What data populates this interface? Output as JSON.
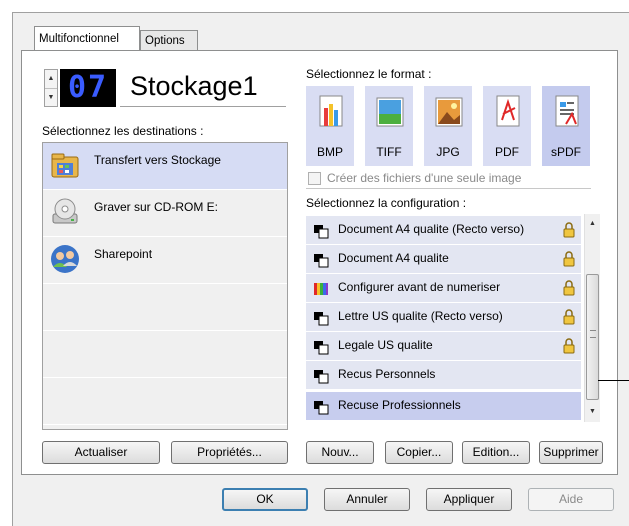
{
  "tabs": [
    {
      "label": "Multifonctionnel"
    },
    {
      "label": "Options"
    }
  ],
  "profile": {
    "number": "07",
    "name": "Stockage1"
  },
  "destinations": {
    "label": "Sélectionnez les destinations :",
    "items": [
      {
        "label": "Transfert vers Stockage",
        "icon": "storage-icon",
        "selected": true
      },
      {
        "label": "Graver sur CD-ROM  E:",
        "icon": "cd-rom-icon",
        "selected": false
      },
      {
        "label": "Sharepoint",
        "icon": "sharepoint-icon",
        "selected": false
      }
    ]
  },
  "format": {
    "label": "Sélectionnez le format :",
    "items": [
      {
        "label": "BMP",
        "icon": "bmp-icon"
      },
      {
        "label": "TIFF",
        "icon": "tiff-icon"
      },
      {
        "label": "JPG",
        "icon": "jpg-icon"
      },
      {
        "label": "PDF",
        "icon": "pdf-icon"
      },
      {
        "label": "sPDF",
        "icon": "spdf-icon",
        "selected": true
      }
    ],
    "single_image_label": "Créer des fichiers d'une seule image"
  },
  "configuration": {
    "label": "Sélectionnez la configuration :",
    "items": [
      {
        "label": "Document A4 qualite (Recto verso)",
        "locked": true
      },
      {
        "label": "Document A4 qualite",
        "locked": true
      },
      {
        "label": "Configurer avant de numeriser",
        "locked": true
      },
      {
        "label": "Lettre US qualite (Recto verso)",
        "locked": true
      },
      {
        "label": "Legale US qualite",
        "locked": true
      },
      {
        "label": "Recus Personnels",
        "locked": false
      },
      {
        "label": "Recuse Professionnels",
        "locked": false,
        "selected": true
      }
    ]
  },
  "buttons": {
    "refresh": "Actualiser",
    "properties": "Propriétés...",
    "new": "Nouv...",
    "copy": "Copier...",
    "edit": "Edition...",
    "delete": "Supprimer",
    "ok": "OK",
    "cancel": "Annuler",
    "apply": "Appliquer",
    "help": "Aide"
  },
  "colors": {
    "lcd_digits": "#3a5cff",
    "selection": "#c7cdee",
    "list_bg": "#e3e6f2"
  }
}
